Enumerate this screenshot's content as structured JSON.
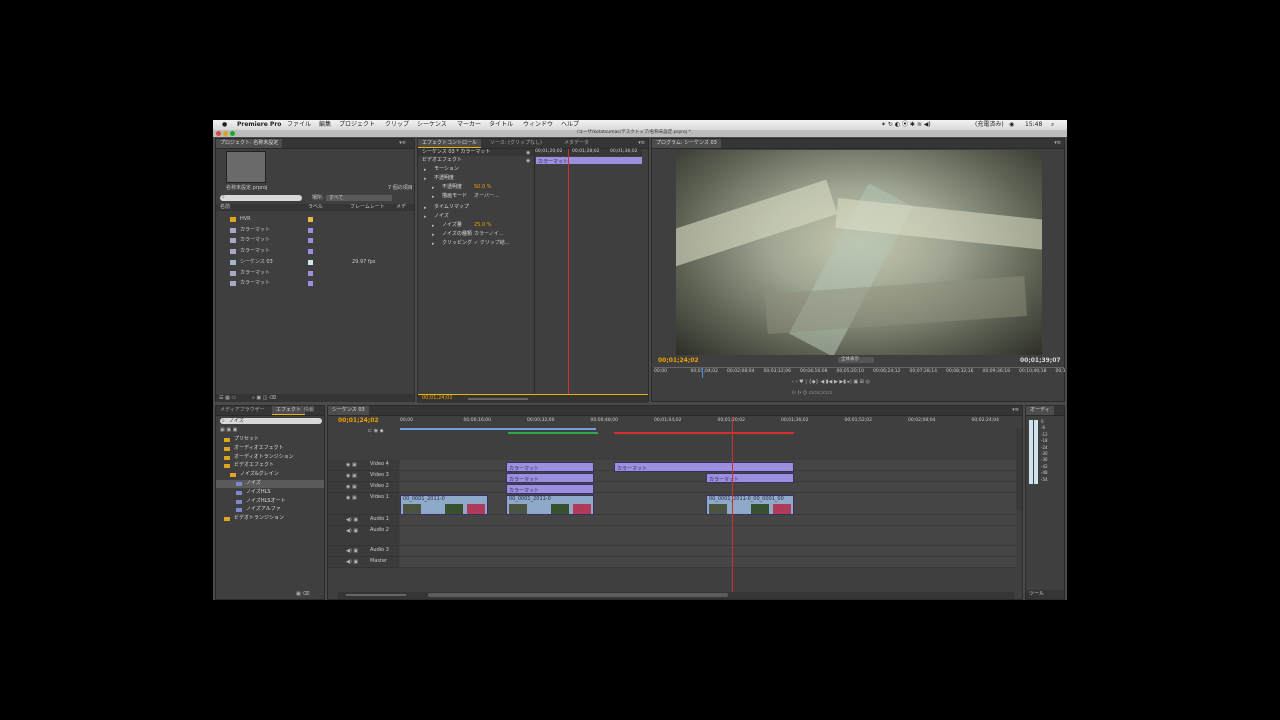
{
  "menubar": {
    "apple": "",
    "app": "Premiere Pro",
    "items": [
      "ファイル",
      "編集",
      "プロジェクト",
      "クリップ",
      "シーケンス",
      "マーカー",
      "タイトル",
      "ウィンドウ",
      "ヘルプ"
    ],
    "status": "(充電済み)",
    "clock": "15:48"
  },
  "titlebar": {
    "path": "/ユーザ/kotatsumac/デスクトップ/名称未設定.prproj *"
  },
  "project": {
    "tab": "プロジェクト: 名称未設定",
    "filename": "名称未設定.prproj",
    "count": "7 個の項目",
    "search_placeholder": "",
    "filter_label": "場所:",
    "filter_value": "すべて",
    "columns": [
      "名前",
      "ラベル",
      "フレームレート",
      "メデ"
    ],
    "items": [
      {
        "name": "HVR",
        "type": "folder",
        "color": "#e8b84a",
        "rate": ""
      },
      {
        "name": "カラーマット",
        "type": "matte",
        "color": "#9b8fe0",
        "rate": ""
      },
      {
        "name": "カラーマット",
        "type": "matte",
        "color": "#9b8fe0",
        "rate": ""
      },
      {
        "name": "カラーマット",
        "type": "matte",
        "color": "#9b8fe0",
        "rate": ""
      },
      {
        "name": "シーケンス 03",
        "type": "sequence",
        "color": "#d0e8e8",
        "rate": "29.97 fps"
      },
      {
        "name": "カラーマット",
        "type": "matte",
        "color": "#9b8fe0",
        "rate": ""
      },
      {
        "name": "カラーマット",
        "type": "matte",
        "color": "#9b8fe0",
        "rate": ""
      }
    ]
  },
  "effect_controls": {
    "tabs": [
      "エフェクトコントロール",
      "ソース: (クリップなし)",
      "メタデータ"
    ],
    "header": "シーケンス 03 * カラーマット",
    "section": "ビデオエフェクト",
    "times": [
      "00;01;20;02",
      "00;01;28;02",
      "00;01;36;02"
    ],
    "clip_label": "カラーマット",
    "rows": [
      {
        "label": "モーション",
        "value": ""
      },
      {
        "label": "不透明度",
        "value": ""
      },
      {
        "label": "不透明度",
        "value": "50.0 %"
      },
      {
        "label": "描画モード",
        "value": "オーバー..."
      },
      {
        "label": "タイムリマップ",
        "value": ""
      },
      {
        "label": "ノイズ",
        "value": ""
      },
      {
        "label": "ノイズ量",
        "value": "25.0 %"
      },
      {
        "label": "ノイズの種類",
        "value": "カラーノイ..."
      },
      {
        "label": "クリッピング",
        "value": "✓ クリップ結..."
      }
    ],
    "current_time": "00;01;24;02"
  },
  "program": {
    "tab": "プログラム: シーケンス 03",
    "timecode": "00;01;24;02",
    "duration": "00;01;39;07",
    "fit": "全体表示",
    "ruler": [
      "00;00",
      "00;01;04;02",
      "00;02;08;04",
      "00;03;12;06",
      "00;04;16;08",
      "00;05;20;10",
      "00;06;24;12",
      "00;07;28;14",
      "00;08;32;16",
      "00;09;36;18",
      "00;10;40;18",
      "00;1"
    ]
  },
  "effects": {
    "tabs": [
      "メディアブラウザー",
      "エフェクト",
      "情報"
    ],
    "search_value": "ノイズ",
    "tree": [
      {
        "label": "プリセット",
        "level": 0,
        "folder": true
      },
      {
        "label": "オーディオエフェクト",
        "level": 0,
        "folder": true
      },
      {
        "label": "オーディオトランジション",
        "level": 0,
        "folder": true
      },
      {
        "label": "ビデオエフェクト",
        "level": 0,
        "folder": true
      },
      {
        "label": "ノイズ&グレイン",
        "level": 1,
        "folder": true
      },
      {
        "label": "ノイズ",
        "level": 2,
        "folder": false,
        "selected": true
      },
      {
        "label": "ノイズHLS",
        "level": 2,
        "folder": false
      },
      {
        "label": "ノイズHLSオート",
        "level": 2,
        "folder": false
      },
      {
        "label": "ノイズアルファ",
        "level": 2,
        "folder": false
      },
      {
        "label": "ビデオトランジション",
        "level": 0,
        "folder": true
      }
    ]
  },
  "timeline": {
    "tab": "シーケンス 03",
    "timecode": "00;01;24;02",
    "ruler": [
      "00;00",
      "00;00;16;00",
      "00;00;32;00",
      "00;00;48;00",
      "00;01;04;02",
      "00;01;20;02",
      "00;01;36;02",
      "00;01;52;02",
      "00;02;08;04",
      "00;02;24;04"
    ],
    "tracks": [
      "Video 4",
      "Video 3",
      "Video 2",
      "Video 1",
      "Audio 1",
      "Audio 2",
      "Audio 3",
      "Master"
    ],
    "matte": "カラーマット",
    "video_clip_a": "00_0001_2011-0",
    "video_clip_b": "00_0001_00",
    "video_clip_c": "00_0001_2011-0_00_0001_00"
  },
  "audio_meter": {
    "tab": "オーディ",
    "labels": [
      "0",
      "-6",
      "-12",
      "-18",
      "-24",
      "-30",
      "-36",
      "-42",
      "-48",
      "-54"
    ]
  },
  "tools": {
    "tab": "ツール"
  },
  "colors": {
    "accent": "#f0a000",
    "matte": "#9b8fe0",
    "playhead": "#d23030",
    "video": "#8fa9c9"
  }
}
